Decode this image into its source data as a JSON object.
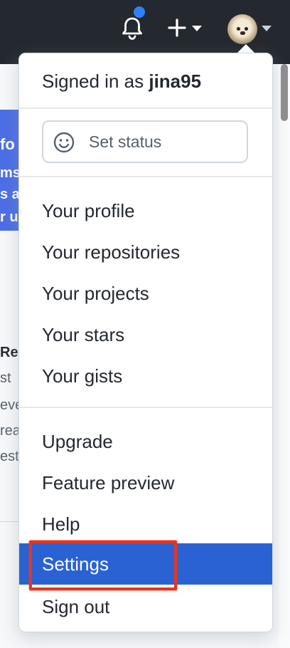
{
  "header": {
    "notifications_icon": "bell-icon",
    "create_icon": "plus-icon",
    "avatar_alt": "dog-avatar"
  },
  "background": {
    "banner_lines": [
      "fo",
      "ms",
      "s a",
      "r u"
    ],
    "side_lines": [
      "Rec",
      "st",
      "eve",
      "rea",
      "est"
    ]
  },
  "dropdown": {
    "signed_in_prefix": "Signed in as",
    "username": "jina95",
    "set_status_label": "Set status",
    "group1": [
      "Your profile",
      "Your repositories",
      "Your projects",
      "Your stars",
      "Your gists"
    ],
    "group2": [
      "Upgrade",
      "Feature preview",
      "Help",
      "Settings",
      "Sign out"
    ],
    "active_item": "Settings"
  },
  "colors": {
    "header_bg": "#24292f",
    "active_bg": "#2a62d4",
    "annotation": "#e8351c",
    "badge": "#2f81f7"
  }
}
